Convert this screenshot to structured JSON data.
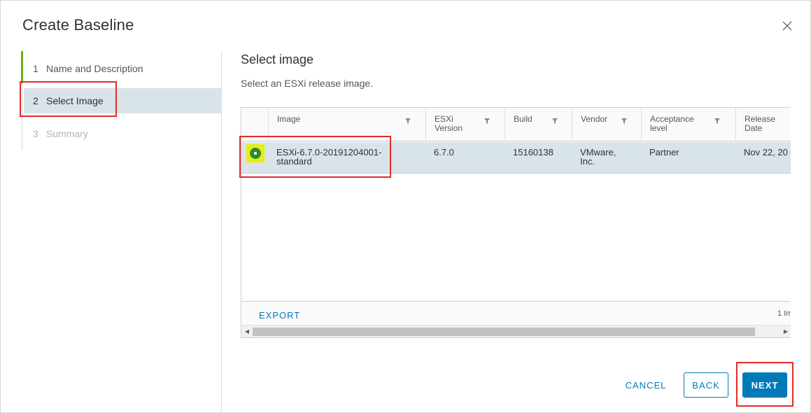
{
  "dialog": {
    "title": "Create Baseline"
  },
  "stepper": {
    "steps": [
      {
        "number": "1",
        "label": "Name and Description",
        "state": "completed"
      },
      {
        "number": "2",
        "label": "Select Image",
        "state": "active"
      },
      {
        "number": "3",
        "label": "Summary",
        "state": "disabled"
      }
    ]
  },
  "content": {
    "title": "Select image",
    "description": "Select an ESXi release image."
  },
  "grid": {
    "columns": [
      {
        "line1": "Image",
        "line2": ""
      },
      {
        "line1": "ESXi",
        "line2": "Version"
      },
      {
        "line1": "Build",
        "line2": ""
      },
      {
        "line1": "Vendor",
        "line2": ""
      },
      {
        "line1": "Acceptance",
        "line2": "level"
      },
      {
        "line1": "Release",
        "line2": "Date"
      }
    ],
    "rows": [
      {
        "selected": true,
        "image_line1": "ESXi-6.7.0-20191204001-",
        "image_line2": "standard",
        "esxi_version": "6.7.0",
        "build": "15160138",
        "vendor_line1": "VMware,",
        "vendor_line2": "Inc.",
        "acceptance": "Partner",
        "release_date": "Nov 22, 20"
      }
    ],
    "footer": {
      "export_label": "EXPORT",
      "count_text": "1 Im"
    }
  },
  "buttons": {
    "cancel": "CANCEL",
    "back": "BACK",
    "next": "NEXT"
  },
  "colors": {
    "accent": "#0079b8",
    "completed_step": "#60b515",
    "selected_row": "#d9e4ea",
    "highlight": "#e12b2b",
    "radio_highlight": "#e6ef14"
  }
}
